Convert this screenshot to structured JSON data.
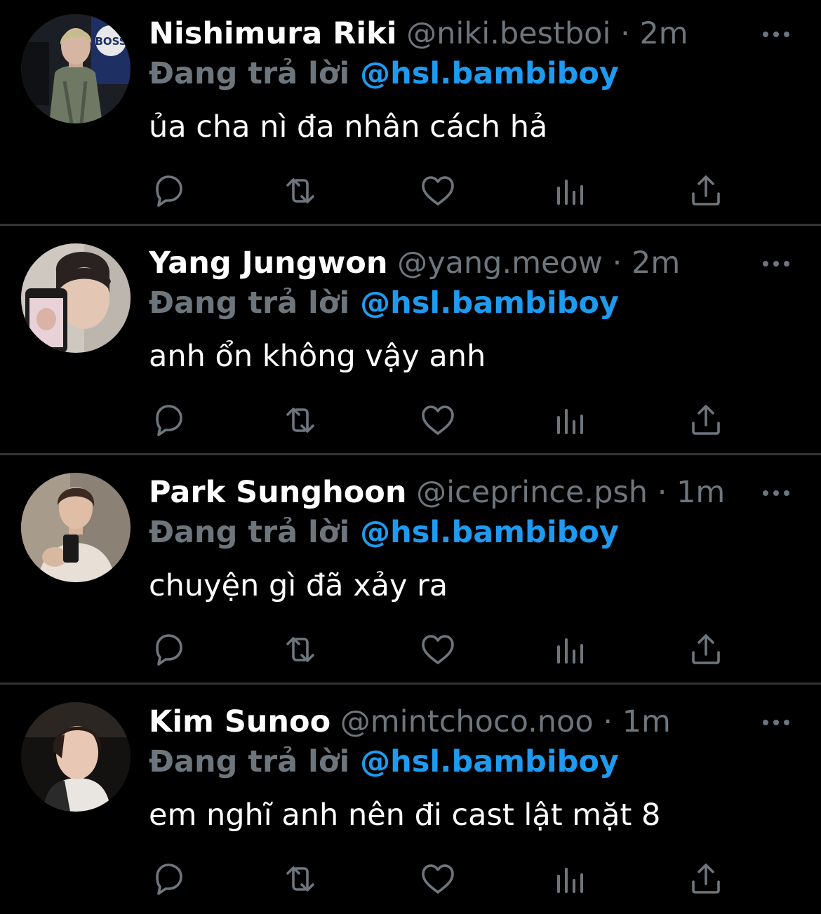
{
  "theme": {
    "background": "#000000",
    "text_primary": "#ffffff",
    "text_secondary": "#6e767d",
    "accent": "#1d9bf0",
    "divider": "#2f3336"
  },
  "tweets": [
    {
      "name": "Nishimura Riki",
      "handle": "@niki.bestboi",
      "separator": "·",
      "time": "2m",
      "reply_prefix": "Đang trả lời",
      "reply_to": "@hsl.bambiboy",
      "text": "ủa cha nì đa nhân cách hả",
      "avatar_logo_text": "BOSS",
      "icons": [
        "more-icon",
        "reply-icon",
        "retweet-icon",
        "like-icon",
        "views-icon",
        "share-icon"
      ]
    },
    {
      "name": "Yang Jungwon",
      "handle": "@yang.meow",
      "separator": "·",
      "time": "2m",
      "reply_prefix": "Đang trả lời",
      "reply_to": "@hsl.bambiboy",
      "text": "anh ổn không vậy anh",
      "icons": [
        "more-icon",
        "reply-icon",
        "retweet-icon",
        "like-icon",
        "views-icon",
        "share-icon"
      ]
    },
    {
      "name": "Park Sunghoon",
      "handle": "@iceprince.psh",
      "separator": "·",
      "time": "1m",
      "reply_prefix": "Đang trả lời",
      "reply_to": "@hsl.bambiboy",
      "text": "chuyện gì đã xảy ra",
      "icons": [
        "more-icon",
        "reply-icon",
        "retweet-icon",
        "like-icon",
        "views-icon",
        "share-icon"
      ]
    },
    {
      "name": "Kim Sunoo",
      "handle": "@mintchoco.noo",
      "separator": "·",
      "time": "1m",
      "reply_prefix": "Đang trả lời",
      "reply_to": "@hsl.bambiboy",
      "text": "em nghĩ anh nên đi cast lật mặt 8",
      "icons": [
        "more-icon",
        "reply-icon",
        "retweet-icon",
        "like-icon",
        "views-icon",
        "share-icon"
      ]
    }
  ]
}
